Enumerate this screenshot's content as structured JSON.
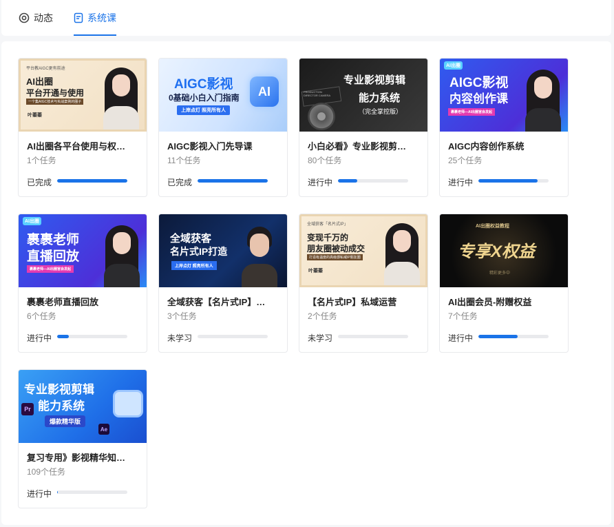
{
  "tabs": [
    {
      "label": "动态",
      "icon": "circle-target-icon",
      "active": false
    },
    {
      "label": "系统课",
      "icon": "document-icon",
      "active": true
    }
  ],
  "colors": {
    "accent": "#1a73e8",
    "track": "#e9eaed"
  },
  "courses": [
    {
      "title": "AI出圈各平台使用与权…",
      "tasks": "1个任务",
      "status": "已完成",
      "progress": 1.0,
      "thumb": {
        "line1": "平台教AIGC更有前途",
        "line2": "AI出圈",
        "line3": "平台开通与使用",
        "line4": "一个集AIGC技术与实战案例的圈子",
        "name": "叶蓁蓁"
      }
    },
    {
      "title": "AIGC影视入门先导课",
      "tasks": "11个任务",
      "status": "已完成",
      "progress": 1.0,
      "thumb": {
        "line1": "AIGC影视",
        "line2": "0基础小白入门指南",
        "line3": "上岸点灯 照亮所有人",
        "badge": "AI"
      }
    },
    {
      "title": "小白必看》专业影视剪…",
      "tasks": "80个任务",
      "status": "进行中",
      "progress": 0.27,
      "thumb": {
        "line1": "专业影视剪辑",
        "line2": "能力系统",
        "line3": "（完全掌控版）",
        "clap": "PRODUCTION DIRECTOR CAMERA"
      }
    },
    {
      "title": "AIGC内容创作系统",
      "tasks": "25个任务",
      "status": "进行中",
      "progress": 0.84,
      "thumb": {
        "line1": "AIGC影视",
        "line2": "内容创作课",
        "line3": "裹裹老师—AI出圈官会发起",
        "logo": "AI出圈"
      }
    },
    {
      "title": "裹裹老师直播回放",
      "tasks": "6个任务",
      "status": "进行中",
      "progress": 0.17,
      "thumb": {
        "line1": "裹裹老师",
        "line2": "直播回放",
        "line3": "裹裹老师—AI出圈官会发起",
        "logo": "AI出圈"
      }
    },
    {
      "title": "全域获客【名片式IP】…",
      "tasks": "3个任务",
      "status": "未学习",
      "progress": 0,
      "thumb": {
        "line1": "全域获客",
        "line2": "名片式IP打造",
        "line3": "上岸点灯 照亮所有人"
      }
    },
    {
      "title": "【名片式IP】私域运营",
      "tasks": "2个任务",
      "status": "未学习",
      "progress": 0,
      "thumb": {
        "line1": "全域获客「名片式IP」",
        "line2": "变现千万的",
        "line3": "朋友圈被动成交",
        "line4": "打造有温度的高级感私域IP朋友圈",
        "name": "叶蓁蓁"
      }
    },
    {
      "title": "AI出圈会员-附赠权益",
      "tasks": "7个任务",
      "status": "进行中",
      "progress": 0.56,
      "thumb": {
        "line1": "AI出圈权益教程",
        "line2": "专享X权益",
        "line3": "精彩更多中"
      }
    },
    {
      "title": "复习专用》影视精华知…",
      "tasks": "109个任务",
      "status": "进行中",
      "progress": 0.01,
      "thumb": {
        "line1": "专业影视剪辑",
        "line2": "能力系统",
        "line3": "爆款精华版",
        "pr": "Pr",
        "ae": "Ae"
      }
    }
  ]
}
